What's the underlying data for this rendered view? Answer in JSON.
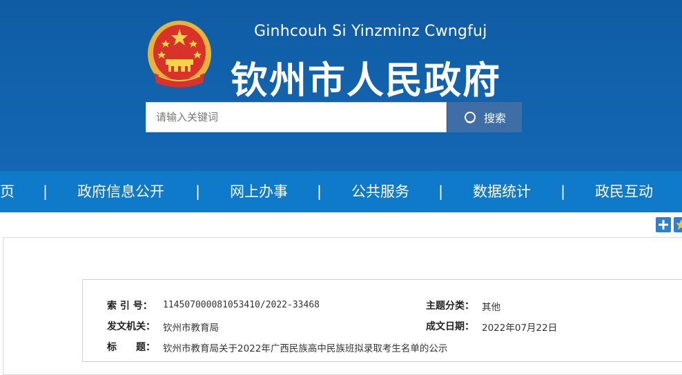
{
  "header": {
    "pinyin_title": "Ginhcouh Si Yinzminz Cwngfuj",
    "title": "钦州市人民政府",
    "search_placeholder": "请输入关键词",
    "search_button": "搜索"
  },
  "nav": {
    "items": [
      "页",
      "政府信息公开",
      "网上办事",
      "公共服务",
      "数据统计",
      "政民互动"
    ],
    "separator": "|"
  },
  "toolbar": {
    "icons": [
      "plus-icon",
      "star-icon"
    ]
  },
  "info": {
    "index_label": "索 引 号：",
    "index_value": "114507000081053410/2022-33468",
    "category_label": "主题分类：",
    "category_value": "其他",
    "issuer_label": "发文机关：",
    "issuer_value": "钦州市教育局",
    "date_label": "成文日期：",
    "date_value": "2022年07月22日",
    "title_label": "标　　题：",
    "title_value": "钦州市教育局关于2022年广西民族高中民族班拟录取考生名单的公示"
  },
  "colors": {
    "header_bg": "#1467b4",
    "nav_bg": "#0e7ac9",
    "search_button_bg": "#3f6ea6"
  }
}
